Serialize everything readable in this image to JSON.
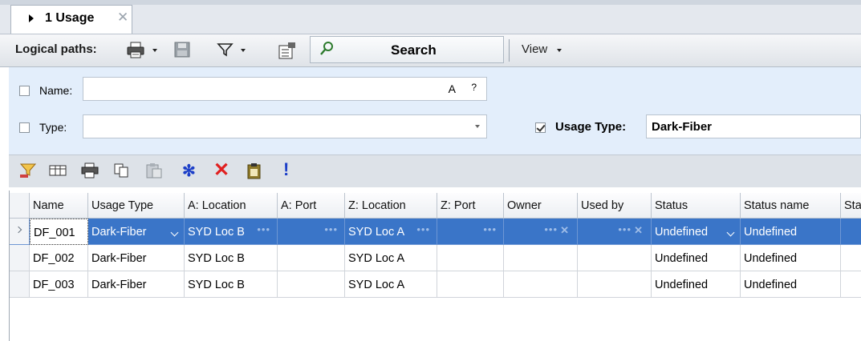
{
  "tab": {
    "label": "1 Usage"
  },
  "toolbar": {
    "title": "Logical paths:",
    "search_label": "Search",
    "view_label": "View"
  },
  "filter": {
    "name_label": "Name:",
    "name_value": "",
    "name_suffix_a": "A",
    "name_suffix_q": "?",
    "type_label": "Type:",
    "type_value": "",
    "usage_type_label": "Usage Type:",
    "usage_type_value": "Dark-Fiber"
  },
  "grid": {
    "columns": [
      "Name",
      "Usage Type",
      "A: Location",
      "A: Port",
      "Z: Location",
      "Z: Port",
      "Owner",
      "Used by",
      "Status",
      "Status name",
      "Sta"
    ],
    "rows": [
      [
        "DF_001",
        "Dark-Fiber",
        "SYD Loc B",
        "",
        "SYD Loc A",
        "",
        "",
        "",
        "Undefined",
        "Undefined",
        ""
      ],
      [
        "DF_002",
        "Dark-Fiber",
        "SYD Loc B",
        "",
        "SYD Loc A",
        "",
        "",
        "",
        "Undefined",
        "Undefined",
        ""
      ],
      [
        "DF_003",
        "Dark-Fiber",
        "SYD Loc B",
        "",
        "SYD Loc A",
        "",
        "",
        "",
        "Undefined",
        "Undefined",
        ""
      ]
    ]
  },
  "icons": {
    "toolbar": [
      "print-icon",
      "save-icon",
      "filter-icon",
      "properties-icon",
      "search-icon"
    ],
    "grid_actions": [
      "filter-edit-icon",
      "column-chooser-icon",
      "print-icon",
      "copy-icon",
      "paste-icon",
      "new-icon",
      "delete-icon",
      "clipboard-icon",
      "alert-icon"
    ]
  }
}
